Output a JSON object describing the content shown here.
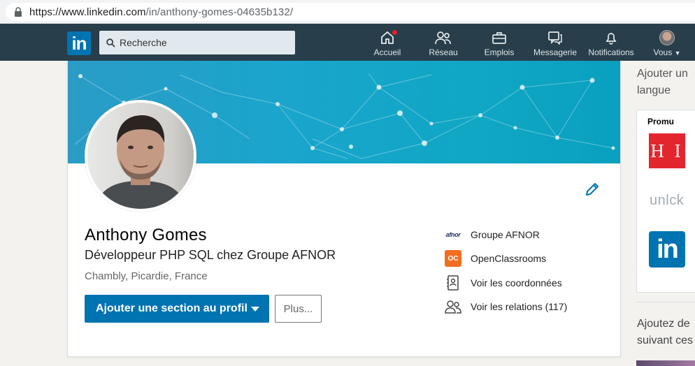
{
  "browser": {
    "url_host": "https://www.linkedin.com",
    "url_path": "/in/anthony-gomes-04635b132/"
  },
  "nav": {
    "logo": "in",
    "search_placeholder": "Recherche",
    "items": [
      {
        "label": "Accueil",
        "icon": "home-icon"
      },
      {
        "label": "Réseau",
        "icon": "network-icon"
      },
      {
        "label": "Emplois",
        "icon": "briefcase-icon"
      },
      {
        "label": "Messagerie",
        "icon": "messaging-icon"
      },
      {
        "label": "Notifications",
        "icon": "bell-icon"
      },
      {
        "label": "Vous",
        "icon": "avatar-icon"
      }
    ],
    "colors": {
      "bar": "#283e4a",
      "brand": "#0073b1",
      "badge": "#e0232e"
    }
  },
  "profile": {
    "name": "Anthony Gomes",
    "headline": "Développeur PHP SQL chez Groupe AFNOR",
    "location": "Chambly, Picardie, France",
    "primary_button": "Ajouter une section au profil",
    "more_button": "Plus...",
    "side": [
      {
        "label": "Groupe AFNOR",
        "icon": "afnor-logo",
        "logo_text": "afnor"
      },
      {
        "label": "OpenClassrooms",
        "icon": "openclassrooms-logo",
        "logo_text": "OC"
      },
      {
        "label": "Voir les coordonnées",
        "icon": "contact-card-icon"
      },
      {
        "label": "Voir les relations (117)",
        "icon": "connections-icon"
      }
    ]
  },
  "right": {
    "heading": "Ajouter un langue",
    "promo_title": "Promu",
    "promo_logos": [
      {
        "icon": "hi-logo",
        "text": "H I"
      },
      {
        "icon": "unlock-logo",
        "text": "unlck"
      },
      {
        "icon": "linkedin-logo",
        "text": "in"
      }
    ],
    "suggest_text": "Ajoutez de suivant ces"
  }
}
